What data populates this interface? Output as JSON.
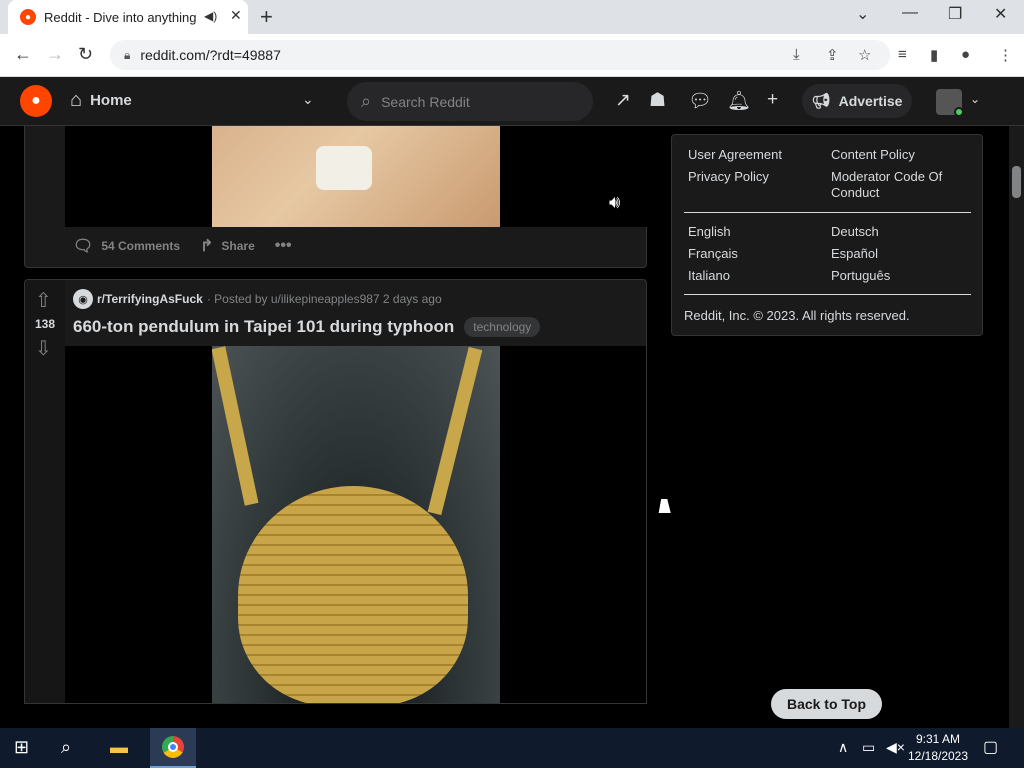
{
  "browser": {
    "tab_title": "Reddit - Dive into anything",
    "url": "reddit.com/?rdt=49887"
  },
  "header": {
    "home_label": "Home",
    "search_placeholder": "Search Reddit",
    "advertise_label": "Advertise"
  },
  "post1": {
    "comments_label": "54 Comments",
    "share_label": "Share"
  },
  "post2": {
    "vote_count": "138",
    "subreddit": "r/TerrifyingAsFuck",
    "posted_by": "· Posted by u/ilikepineapples987 2 days ago",
    "title": "660-ton pendulum in Taipei 101 during typhoon",
    "flair": "technology"
  },
  "footer": {
    "links": {
      "user_agreement": "User Agreement",
      "content_policy": "Content Policy",
      "privacy_policy": "Privacy Policy",
      "mod_code_line1": "Moderator Code Of",
      "mod_code_line2": "Conduct"
    },
    "languages": {
      "english": "English",
      "deutsch": "Deutsch",
      "francais": "Français",
      "espanol": "Español",
      "italiano": "Italiano",
      "portugues": "Português"
    },
    "copyright": "Reddit, Inc. © 2023. All rights reserved."
  },
  "back_to_top": "Back to Top",
  "taskbar": {
    "time": "9:31 AM",
    "date": "12/18/2023"
  }
}
